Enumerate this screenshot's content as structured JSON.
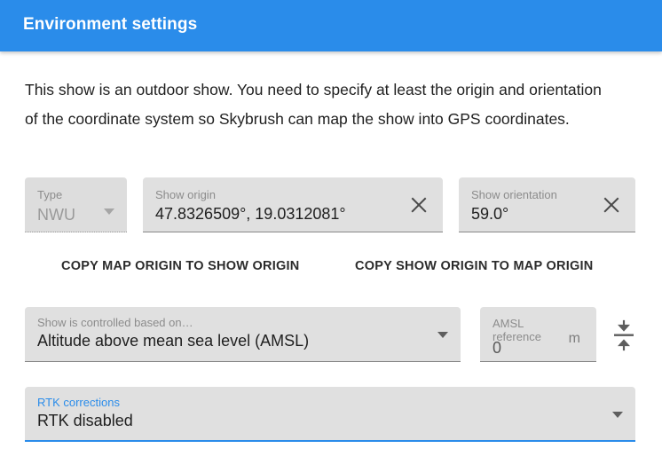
{
  "header": {
    "title": "Environment settings",
    "accent_color": "#2a8cea"
  },
  "intro": {
    "text": "This show is an outdoor show. You need to specify at least the origin and orientation of the coordinate system so Skybrush can map the show into GPS coordinates."
  },
  "form": {
    "type": {
      "label": "Type",
      "value": "NWU",
      "disabled": true,
      "icon": "chevron-down-icon"
    },
    "show_origin": {
      "label": "Show origin",
      "value": "47.8326509°, 19.0312081°",
      "clear_icon": "close-icon"
    },
    "show_orientation": {
      "label": "Show orientation",
      "value": "59.0°",
      "clear_icon": "close-icon"
    },
    "copy_map_to_show": {
      "label": "COPY MAP ORIGIN TO SHOW ORIGIN"
    },
    "copy_show_to_map": {
      "label": "COPY SHOW ORIGIN TO MAP ORIGIN"
    },
    "altitude_reference": {
      "label": "Show is controlled based on…",
      "value": "Altitude above mean sea level (AMSL)",
      "icon": "chevron-down-icon"
    },
    "amsl_reference": {
      "label": "AMSL reference",
      "value": "0",
      "unit": "m"
    },
    "fit_to_ground": {
      "icon": "vertical-compress-icon"
    },
    "rtk_corrections": {
      "label": "RTK corrections",
      "value": "RTK disabled",
      "focused": true,
      "label_color": "#2a8cea",
      "icon": "chevron-down-icon"
    }
  }
}
